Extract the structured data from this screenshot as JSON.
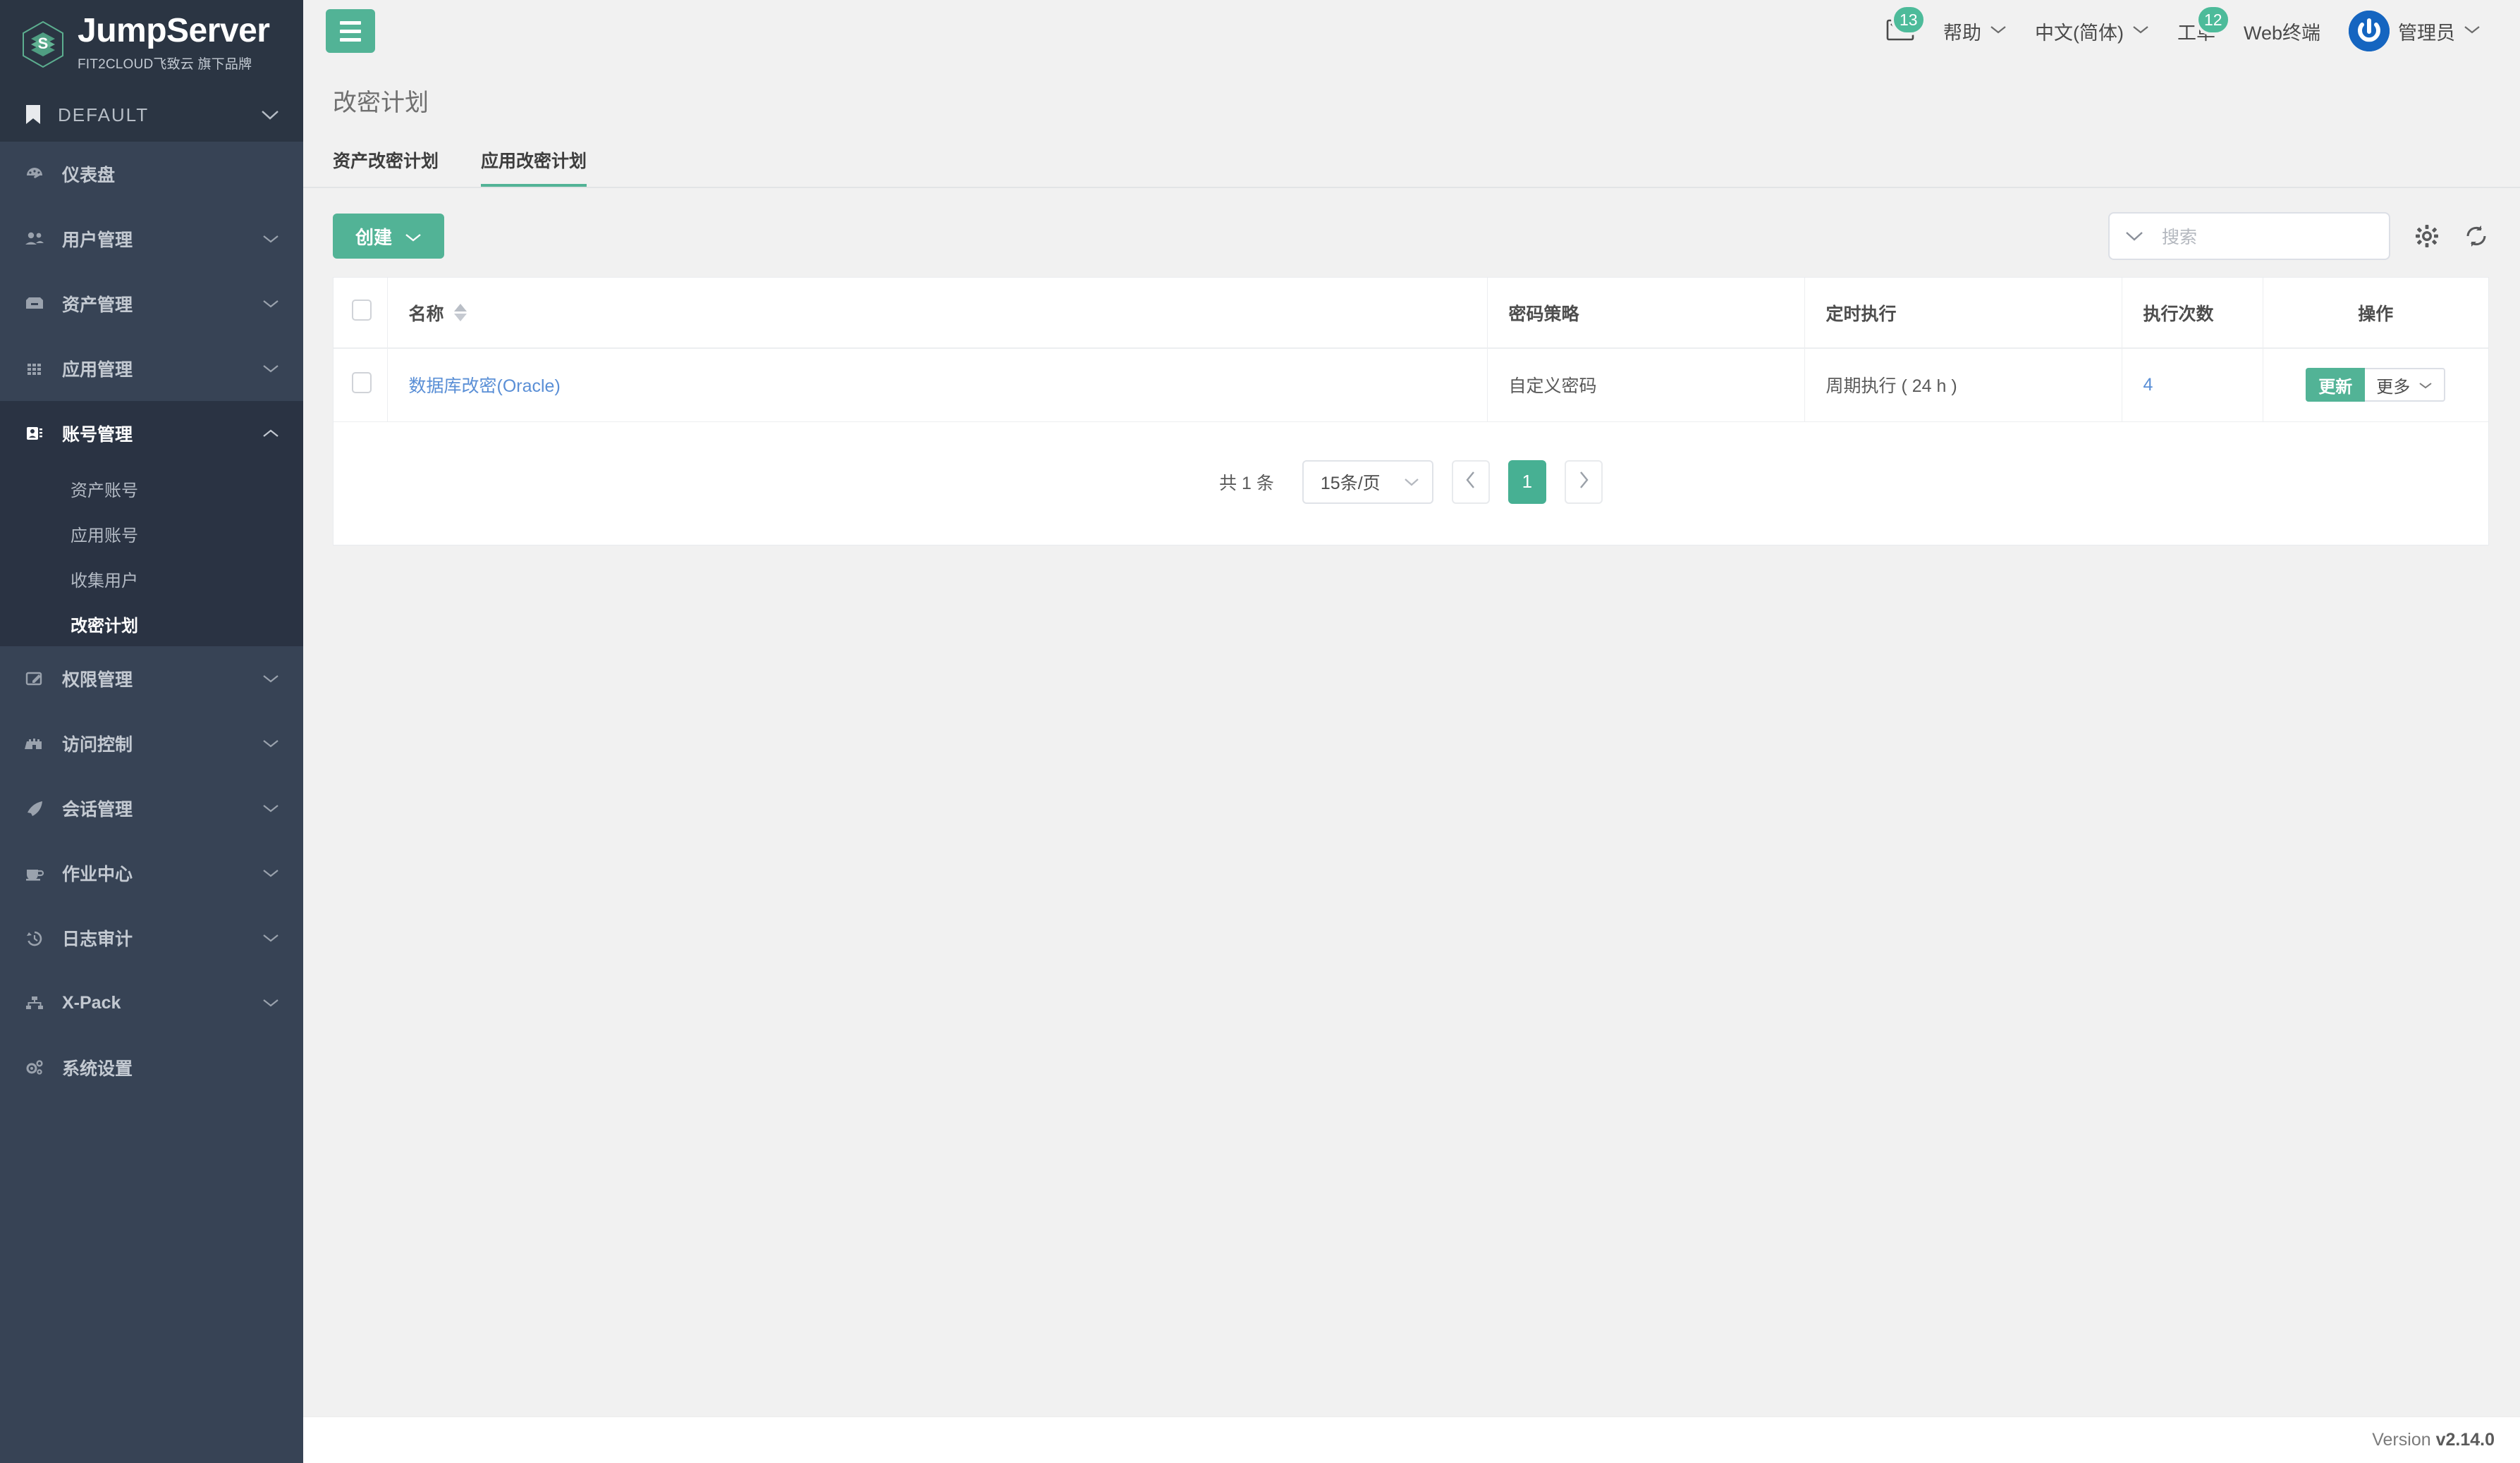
{
  "brand": {
    "title": "JumpServer",
    "subtitle": "FIT2CLOUD飞致云 旗下品牌",
    "logo_icon": "jumpserver-logo-icon"
  },
  "sidebar": {
    "org": {
      "label": "DEFAULT",
      "icon": "bookmark-icon",
      "chevron": "chevron-down-icon"
    },
    "items": [
      {
        "label": "仪表盘",
        "icon": "dashboard-icon",
        "expandable": false
      },
      {
        "label": "用户管理",
        "icon": "users-icon",
        "expandable": true
      },
      {
        "label": "资产管理",
        "icon": "inbox-icon",
        "expandable": true
      },
      {
        "label": "应用管理",
        "icon": "grid-icon",
        "expandable": true
      },
      {
        "label": "账号管理",
        "icon": "contact-card-icon",
        "expandable": true,
        "open": true,
        "children": [
          {
            "label": "资产账号",
            "active": false
          },
          {
            "label": "应用账号",
            "active": false
          },
          {
            "label": "收集用户",
            "active": false
          },
          {
            "label": "改密计划",
            "active": true
          }
        ]
      },
      {
        "label": "权限管理",
        "icon": "edit-square-icon",
        "expandable": true
      },
      {
        "label": "访问控制",
        "icon": "castle-icon",
        "expandable": true
      },
      {
        "label": "会话管理",
        "icon": "rocket-icon",
        "expandable": true
      },
      {
        "label": "作业中心",
        "icon": "cup-icon",
        "expandable": true
      },
      {
        "label": "日志审计",
        "icon": "history-icon",
        "expandable": true
      },
      {
        "label": "X-Pack",
        "icon": "sitemap-icon",
        "expandable": true
      },
      {
        "label": "系统设置",
        "icon": "gears-icon",
        "expandable": false
      }
    ]
  },
  "topbar": {
    "menu_toggle_icon": "hamburger-icon",
    "mail_icon": "mail-icon",
    "mail_badge": "13",
    "help_label": "帮助",
    "language_label": "中文(简体)",
    "ticket_label": "工单",
    "ticket_badge": "12",
    "webterminal_label": "Web终端",
    "user_label": "管理员",
    "avatar_icon": "power-avatar-icon",
    "chevron_icon": "chevron-down-icon"
  },
  "page": {
    "title": "改密计划",
    "tabs": [
      {
        "label": "资产改密计划",
        "active": false
      },
      {
        "label": "应用改密计划",
        "active": true
      }
    ]
  },
  "toolbar": {
    "create_label": "创建",
    "create_chevron_icon": "chevron-down-icon",
    "search_placeholder": "搜索",
    "search_value": "",
    "search_chevron_icon": "chevron-down-icon",
    "settings_icon": "gear-icon",
    "refresh_icon": "refresh-icon"
  },
  "table": {
    "select_all_checkbox": "unchecked",
    "columns": [
      {
        "label": "名称",
        "sortable": true
      },
      {
        "label": "密码策略",
        "sortable": false
      },
      {
        "label": "定时执行",
        "sortable": false
      },
      {
        "label": "执行次数",
        "sortable": false
      },
      {
        "label": "操作",
        "sortable": false
      }
    ],
    "rows": [
      {
        "checkbox": "unchecked",
        "name": "数据库改密(Oracle)",
        "password_policy": "自定义密码",
        "schedule": "周期执行 ( 24 h )",
        "run_count": "4",
        "update_label": "更新",
        "more_label": "更多"
      }
    ]
  },
  "pagination": {
    "total_label": "共 1 条",
    "page_size_label": "15条/页",
    "prev_icon": "chevron-left-icon",
    "next_icon": "chevron-right-icon",
    "current_page": "1"
  },
  "footer": {
    "version_prefix": "Version",
    "version_number": "v2.14.0"
  },
  "colors": {
    "accent_green": "#52b396",
    "sidebar_bg": "#374355",
    "sidebar_dark": "#2b3543",
    "submenu_bg": "#2a3343",
    "link_blue": "#5a8fd6",
    "avatar_blue": "#1565c0",
    "page_bg": "#f1f1f1"
  }
}
